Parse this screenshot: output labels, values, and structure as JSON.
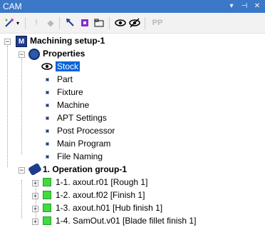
{
  "window": {
    "title": "CAM",
    "controls": [
      "▾",
      "⊣",
      "✕"
    ]
  },
  "toolbar": {
    "icons": [
      "wand-icon",
      "dropdown-arrow-icon",
      "exclamation-icon",
      "diamond-icon",
      "tool-arrow-icon",
      "sparkle-icon",
      "folder-icon",
      "eye-icon",
      "eye-off-icon",
      "pp-icon"
    ],
    "pp_label": "PP"
  },
  "tree": {
    "setup": {
      "label": "Machining setup-1"
    },
    "properties": {
      "label": "Properties",
      "items": [
        {
          "label": "Stock",
          "selected": true
        },
        {
          "label": "Part"
        },
        {
          "label": "Fixture"
        },
        {
          "label": "Machine"
        },
        {
          "label": "APT Settings"
        },
        {
          "label": "Post Processor"
        },
        {
          "label": "Main Program"
        },
        {
          "label": "File Naming"
        }
      ]
    },
    "operation_group": {
      "label": "1. Operation group-1",
      "operations": [
        {
          "label": "1-1. axout.r01 [Rough 1]"
        },
        {
          "label": "1-2. axout.f02 [Finish 1]"
        },
        {
          "label": "1-3. axout.h01 [Hub finish 1]"
        },
        {
          "label": "1-4. SamOut.v01 [Blade fillet finish 1]"
        }
      ]
    }
  },
  "colors": {
    "titlebar": "#3c78c8",
    "selection": "#0a64d8",
    "status_ok": "#3fdc3f"
  }
}
